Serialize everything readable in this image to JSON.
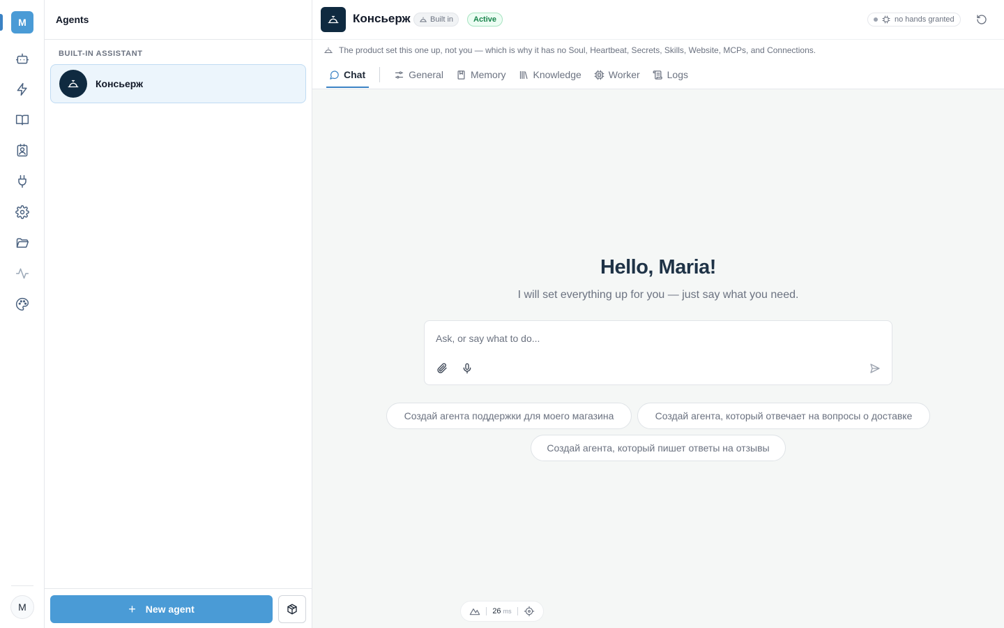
{
  "rail": {
    "logo_letter": "M",
    "user_initial": "M",
    "icons": [
      "bot-icon",
      "zap-icon",
      "book-icon",
      "contact-icon",
      "plug-icon",
      "gear-icon",
      "folder-icon",
      "activity-icon",
      "palette-icon"
    ]
  },
  "agents_panel": {
    "title": "Agents",
    "section_label": "BUILT-IN ASSISTANT",
    "agents": [
      {
        "name": "Консьерж"
      }
    ],
    "new_agent_label": "New agent"
  },
  "header": {
    "agent_name": "Консьерж",
    "badge_builtin": "Built in",
    "badge_active": "Active",
    "hands_status": "no hands granted",
    "notice": "The product set this one up, not you — which is why it has no Soul, Heartbeat, Secrets, Skills, Website, MCPs, and Connections."
  },
  "tabs": [
    {
      "label": "Chat",
      "icon": "chat-bubble-icon"
    },
    {
      "label": "General",
      "icon": "sliders-icon"
    },
    {
      "label": "Memory",
      "icon": "bookmark-icon"
    },
    {
      "label": "Knowledge",
      "icon": "library-icon"
    },
    {
      "label": "Worker",
      "icon": "cpu-icon"
    },
    {
      "label": "Logs",
      "icon": "scroll-icon"
    }
  ],
  "chat": {
    "greeting": "Hello, Maria!",
    "subtitle": "I will set everything up for you — just say what you need.",
    "placeholder": "Ask, or say what to do...",
    "suggestions": [
      "Создай агента поддержки для моего магазина",
      "Создай агента, который отвечает на вопросы о доставке",
      "Создай агента, который пишет ответы на отзывы"
    ]
  },
  "dev_bar": {
    "latency_value": "26",
    "latency_unit": "ms"
  },
  "colors": {
    "accent": "#4a9bd6",
    "avatar_bg": "#0f2a40",
    "active_green": "#16834a"
  }
}
